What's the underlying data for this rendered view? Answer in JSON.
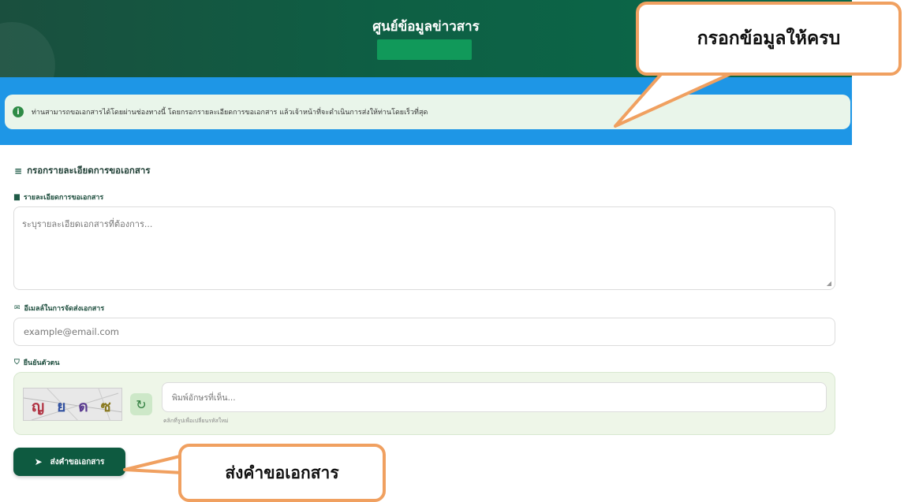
{
  "header": {
    "title": "ศูนย์ข้อมูลข่าวสาร"
  },
  "alert": {
    "text": "ท่านสามารถขอเอกสารได้โดยผ่านช่องทางนี้ โดยกรอกรายละเอียดการขอเอกสาร แล้วเจ้าหน้าที่จะดำเนินการส่งให้ท่านโดยเร็วที่สุด"
  },
  "form": {
    "section_title": "กรอกรายละเอียดการขอเอกสาร",
    "details_label": "รายละเอียดการขอเอกสาร",
    "details_placeholder": "ระบุรายละเอียดเอกสารที่ต้องการ...",
    "email_label": "อีเมลล์ในการจัดส่งเอกสาร",
    "email_placeholder": "example@email.com",
    "verify_label": "ยืนยันตัวตน",
    "captcha_chars": [
      "ญ",
      "ย",
      "ด",
      "ซ"
    ],
    "captcha_placeholder": "พิมพ์อักษรที่เห็น...",
    "captcha_hint": "คลิกที่รูปเพื่อเปลี่ยนรหัสใหม่",
    "submit_label": "ส่งคำขอเอกสาร"
  },
  "annotations": {
    "callout_fill_form": "กรอกข้อมูลให้ครบ",
    "callout_submit": "ส่งคำขอเอกสาร"
  },
  "icons": {
    "alert": "info-icon",
    "section": "edit-list-icon",
    "details": "document-icon",
    "email": "envelope-icon",
    "verify": "shield-icon",
    "refresh": "refresh-icon",
    "submit": "send-icon"
  },
  "colors": {
    "header_dark": "#1a4f3e",
    "band_blue": "#1e96e6",
    "alert_bg": "#e9f5ea",
    "primary": "#0e5a40",
    "callout_border": "#f0a060"
  }
}
